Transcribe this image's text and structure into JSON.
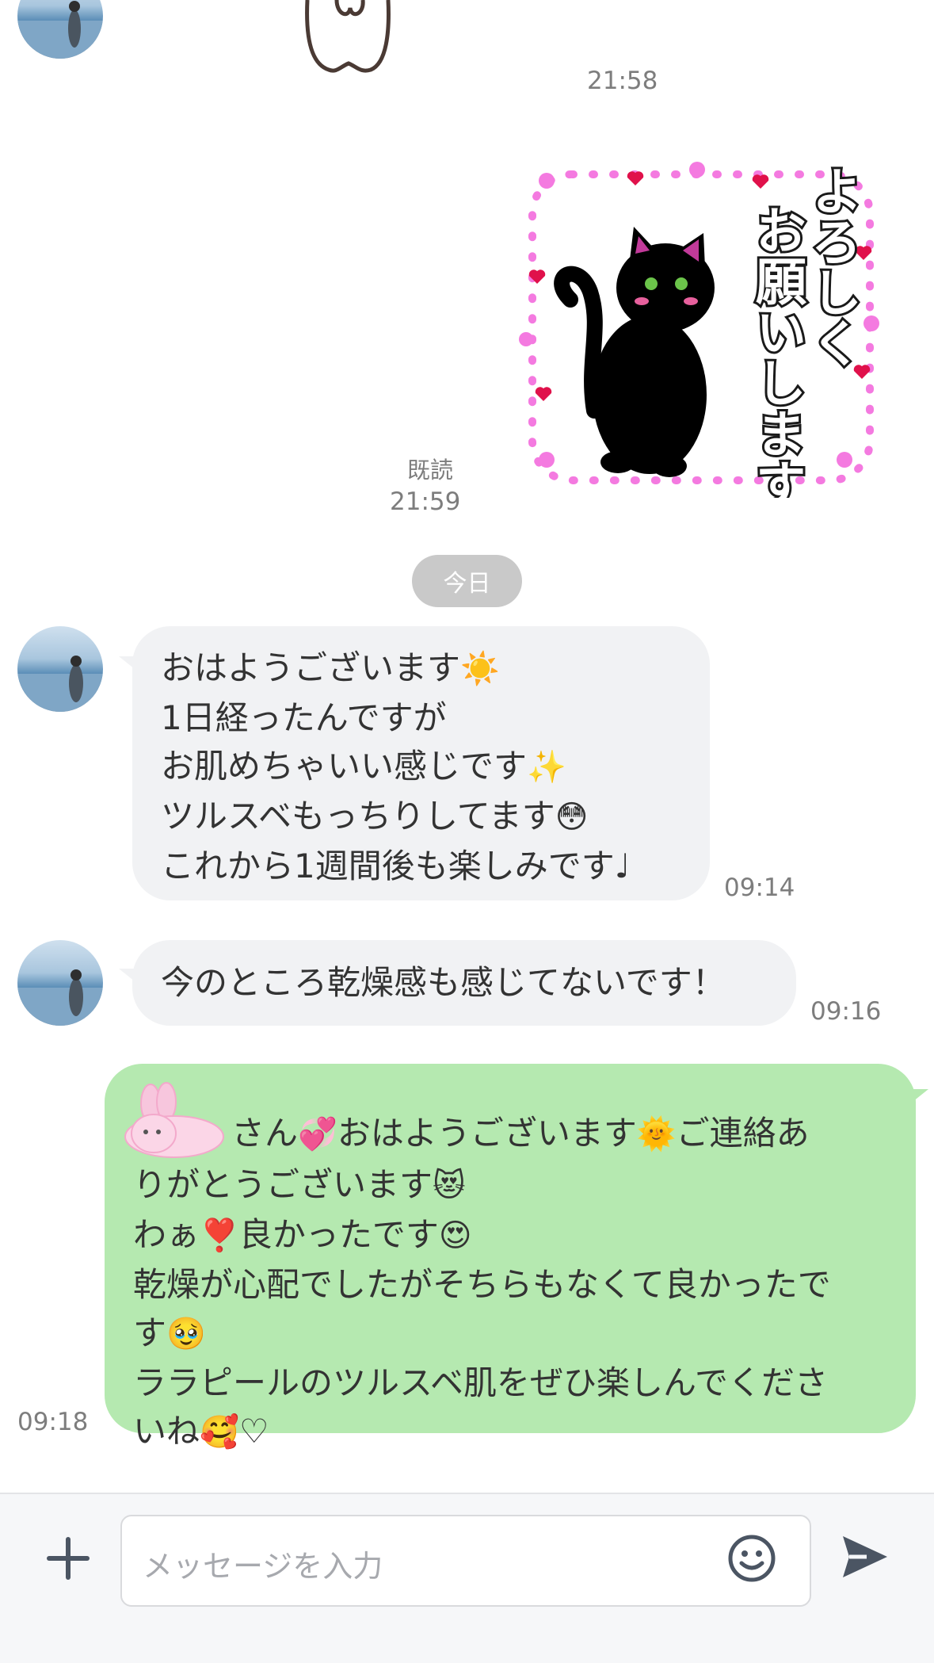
{
  "messages": {
    "prev_time": "21:58",
    "sticker": {
      "text_col1": "よろしく",
      "text_col2": "お願いします"
    },
    "read_label": "既読",
    "sent_time": "21:59",
    "date_divider": "今日",
    "incoming1": {
      "lines": [
        {
          "text": "おはようございます",
          "emoji": "☀️"
        },
        {
          "text": "1日経ったんですが",
          "emoji": ""
        },
        {
          "text": "お肌めちゃいい感じです",
          "emoji": "✨"
        },
        {
          "text": "ツルスベもっちりしてます",
          "emoji": "😳"
        },
        {
          "text": "これから1週間後も楽しみです♩",
          "emoji": ""
        }
      ],
      "time": "09:14"
    },
    "incoming2": {
      "text": "今のところ乾燥感も感じてないです！",
      "time": "09:16"
    },
    "outgoing": {
      "line1_a": "さん",
      "line1_emoji1": "💞",
      "line1_b": "おはようございます",
      "line1_emoji2": "🌞",
      "line1_c": "ご連絡あ",
      "line2": "りがとうございます",
      "line2_emoji": "😻",
      "line3_a": "わぁ",
      "line3_emoji1": "❣️",
      "line3_b": "良かったです",
      "line3_emoji2": "😍",
      "line4": "乾燥が心配でしたがそちらもなくて良かったで",
      "line5": "す",
      "line5_emoji": "🥹",
      "line6": "ララピールのツルスベ肌をぜひ楽しんでくださ",
      "line7": "いね",
      "line7_emoji": "🥰",
      "line7_end": "♡",
      "time": "09:18"
    }
  },
  "input": {
    "placeholder": "メッセージを入力"
  },
  "icons": {
    "add": "plus-icon",
    "emoji": "smiley-icon",
    "send": "send-icon"
  },
  "colors": {
    "outgoing_bubble": "#b5e9b0",
    "incoming_bubble": "#f1f2f4",
    "accent_icon": "#4b5563"
  }
}
